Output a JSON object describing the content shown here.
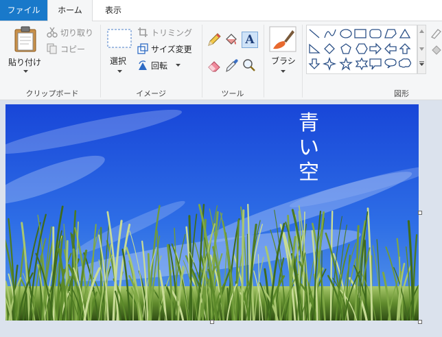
{
  "menu": {
    "tabs": [
      {
        "label": "ファイル"
      },
      {
        "label": "ホーム"
      },
      {
        "label": "表示"
      }
    ]
  },
  "ribbon": {
    "clipboard": {
      "paste_label": "貼り付け",
      "cut_label": "切り取り",
      "copy_label": "コピー",
      "group_label": "クリップボード"
    },
    "image": {
      "select_label": "選択",
      "crop_label": "トリミング",
      "resize_label": "サイズ変更",
      "rotate_label": "回転",
      "group_label": "イメージ"
    },
    "tools": {
      "group_label": "ツール",
      "text_tool_glyph": "A"
    },
    "brushes": {
      "label": "ブラシ"
    },
    "shapes": {
      "group_label": "図形"
    }
  },
  "canvas": {
    "text_chars": [
      "青",
      "い",
      "空"
    ],
    "sky_top": "#1846d8",
    "sky_bottom": "#5a9be8",
    "grass_color": "#6f9a3a"
  }
}
